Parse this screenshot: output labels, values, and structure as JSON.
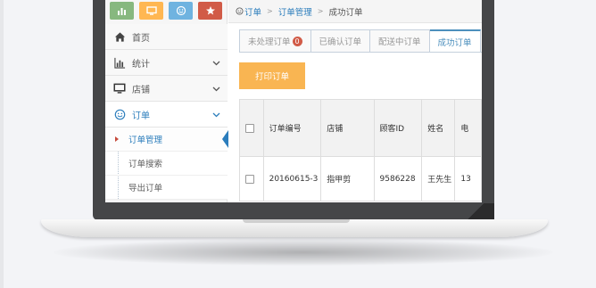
{
  "quick_buttons": [
    {
      "icon": "bar-chart-icon",
      "color": "#87b87f"
    },
    {
      "icon": "monitor-icon",
      "color": "#ffb752"
    },
    {
      "icon": "smile-icon",
      "color": "#6fb3e0"
    },
    {
      "icon": "star-icon",
      "color": "#d15b47"
    }
  ],
  "sidebar": {
    "items": [
      {
        "label": "首页",
        "icon": "home-icon"
      },
      {
        "label": "统计",
        "icon": "bar-chart-icon"
      },
      {
        "label": "店铺",
        "icon": "monitor-icon"
      },
      {
        "label": "订单",
        "icon": "smile-icon"
      }
    ],
    "submenu": [
      {
        "label": "订单管理"
      },
      {
        "label": "订单搜索"
      },
      {
        "label": "导出订单"
      }
    ]
  },
  "breadcrumb": {
    "items": [
      "订单",
      "订单管理",
      "成功订单"
    ]
  },
  "tabs": [
    {
      "label": "未处理订单",
      "badge": "0"
    },
    {
      "label": "已确认订单"
    },
    {
      "label": "配送中订单"
    },
    {
      "label": "成功订单"
    }
  ],
  "actions": {
    "print_label": "打印订单"
  },
  "table": {
    "headers": [
      "订单编号",
      "店铺",
      "顾客ID",
      "姓名",
      "电"
    ],
    "rows": [
      [
        "20160615-3",
        "指甲剪",
        "9586228",
        "王先生",
        "13"
      ]
    ]
  },
  "colors": {
    "accent": "#2b7dbc",
    "print_button": "#f9b552",
    "badge": "#d15b47"
  }
}
